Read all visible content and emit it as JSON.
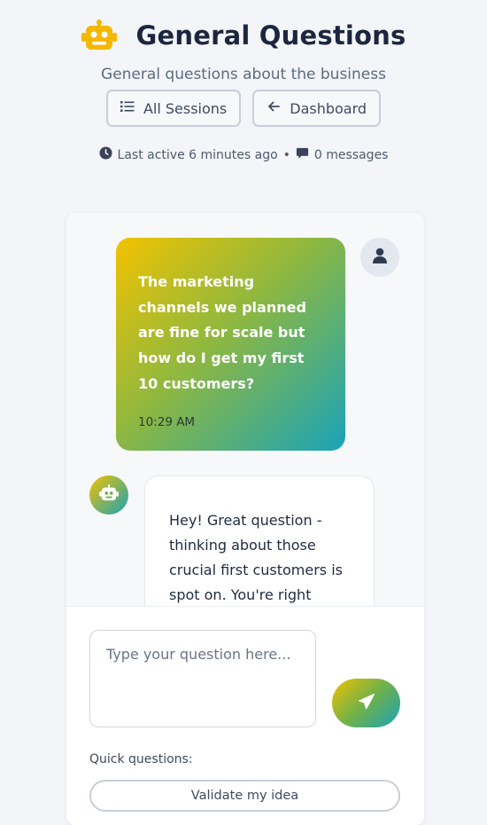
{
  "header": {
    "title": "General Questions",
    "subtitle": "General questions about the business",
    "icon": "robot-icon"
  },
  "nav": {
    "all_sessions_label": "All Sessions",
    "dashboard_label": "Dashboard"
  },
  "meta": {
    "last_active": "Last active 6 minutes ago",
    "separator": "•",
    "message_count": "0 messages"
  },
  "chat": {
    "messages": [
      {
        "role": "user",
        "text": "The marketing channels we planned are fine for scale but how do I get my first 10 customers?",
        "time": "10:29 AM"
      },
      {
        "role": "assistant",
        "text": "Hey! Great question - thinking about those crucial first customers is spot on. You're right"
      }
    ]
  },
  "input": {
    "placeholder": "Type your question here..."
  },
  "quick_questions": {
    "label": "Quick questions:",
    "items": [
      "Validate my idea"
    ]
  },
  "colors": {
    "gradient_start": "#f2c200",
    "gradient_end": "#1aa3b8",
    "title": "#1d2640",
    "robot": "#f5b800"
  }
}
